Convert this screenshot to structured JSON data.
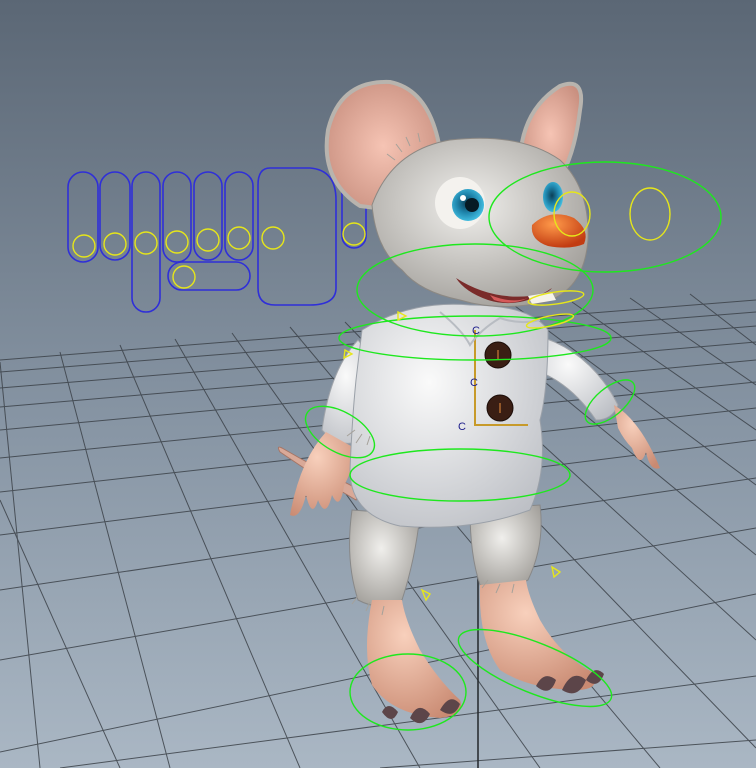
{
  "viewport": {
    "background_top": "#5b6775",
    "background_bottom": "#a9b6c4",
    "grid_color": "#3c4249",
    "rig_curve_color": "#2f2fd8",
    "control_color": "#1ee81e",
    "handle_color": "#e6e61a",
    "cluster_label_color": "#1b1b8a"
  },
  "cluster_handles": [
    {
      "label": "C"
    },
    {
      "label": "C"
    },
    {
      "label": "C"
    }
  ],
  "character": {
    "name": "mouse-character",
    "fur_color": "#d8d6d2",
    "shirt_color": "#eeeeee",
    "nose_color": "#e8641e",
    "eye_color": "#2aa0c8",
    "button_color": "#3a1e14",
    "skin_color": "#f0c0a8"
  }
}
